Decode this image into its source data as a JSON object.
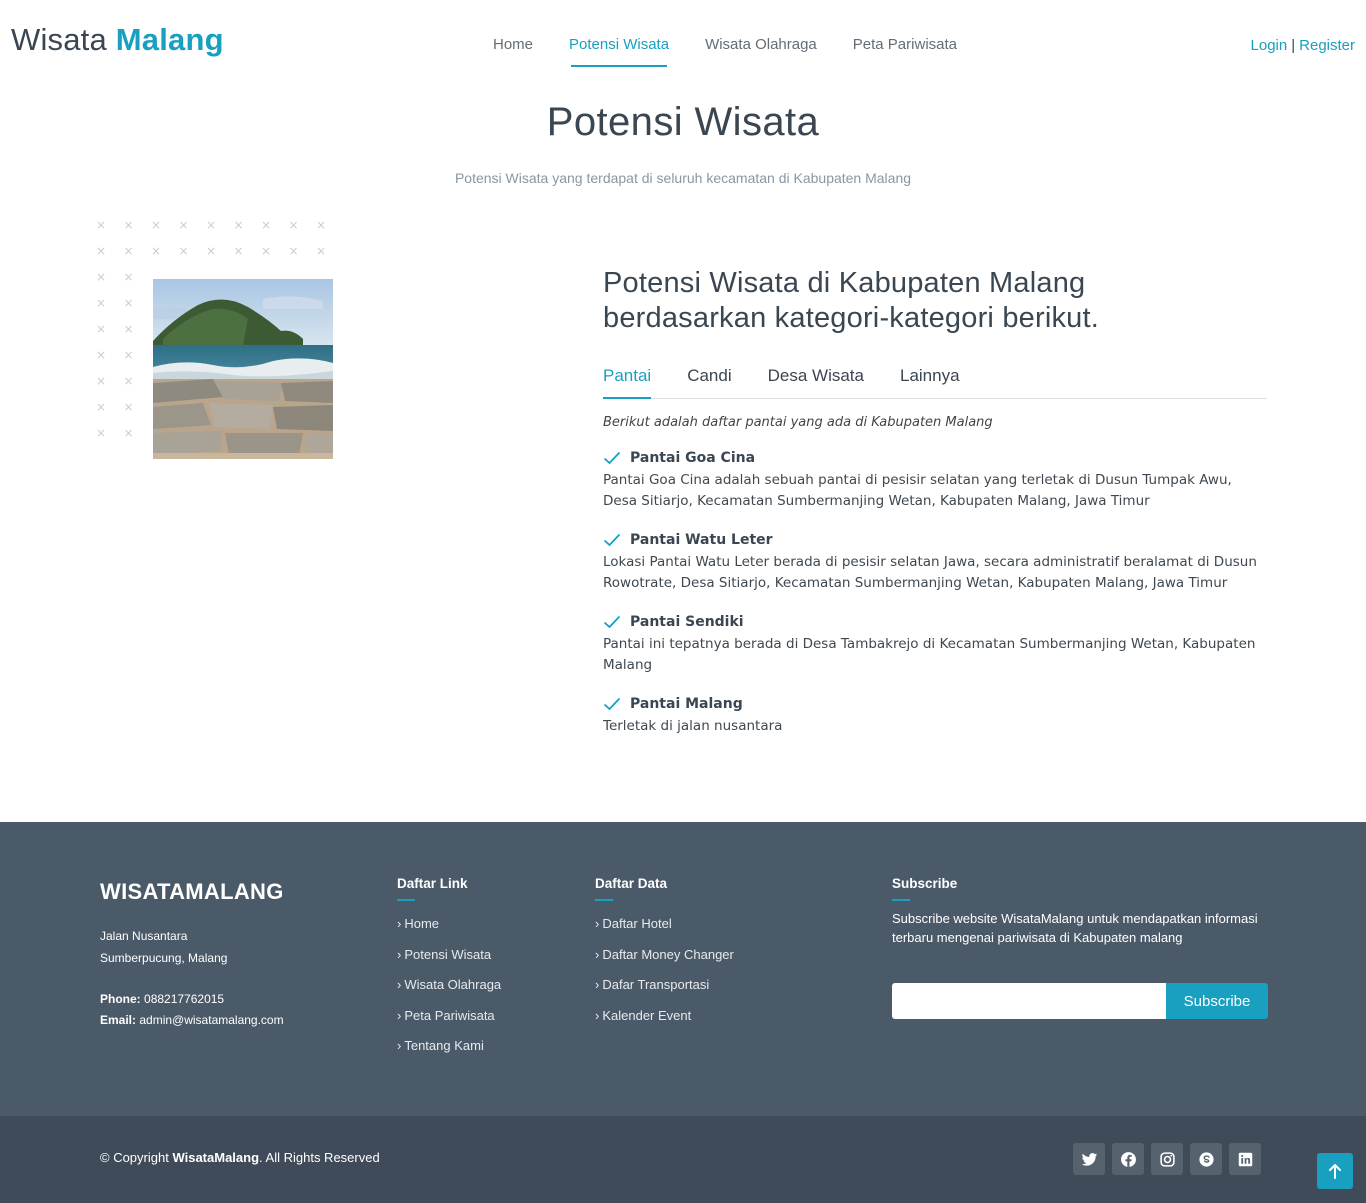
{
  "header": {
    "logo_part1": "Wisata",
    "logo_part2": "Malang",
    "nav": [
      {
        "label": "Home",
        "active": false
      },
      {
        "label": "Potensi Wisata",
        "active": true
      },
      {
        "label": "Wisata Olahraga",
        "active": false
      },
      {
        "label": "Peta Pariwisata",
        "active": false
      }
    ],
    "login": "Login",
    "separator": "|",
    "register": "Register"
  },
  "section": {
    "title": "Potensi Wisata",
    "subtitle": "Potensi Wisata yang terdapat di seluruh kecamatan di Kabupaten Malang"
  },
  "content": {
    "heading_line1": "Potensi Wisata di Kabupaten Malang",
    "heading_line2": "berdasarkan kategori-kategori berikut.",
    "tabs": [
      {
        "label": "Pantai",
        "active": true
      },
      {
        "label": "Candi",
        "active": false
      },
      {
        "label": "Desa Wisata",
        "active": false
      },
      {
        "label": "Lainnya",
        "active": false
      }
    ],
    "intro": "Berikut adalah daftar pantai yang ada di Kabupaten Malang",
    "items": [
      {
        "title": "Pantai Goa Cina",
        "desc": "Pantai Goa Cina adalah sebuah pantai di pesisir selatan yang terletak di Dusun Tumpak Awu, Desa Sitiarjo, Kecamatan Sumbermanjing Wetan, Kabupaten Malang, Jawa Timur"
      },
      {
        "title": "Pantai Watu Leter",
        "desc": "Lokasi Pantai Watu Leter berada di pesisir selatan Jawa, secara administratif beralamat di Dusun Rowotrate, Desa Sitiarjo, Kecamatan Sumbermanjing Wetan, Kabupaten Malang, Jawa Timur"
      },
      {
        "title": "Pantai Sendiki",
        "desc": "Pantai ini tepatnya berada di Desa Tambakrejo di Kecamatan Sumbermanjing Wetan, Kabupaten Malang"
      },
      {
        "title": "Pantai Malang",
        "desc": "Terletak di jalan nusantara"
      }
    ]
  },
  "footer": {
    "brand": "WISATAMALANG",
    "address_line1": "Jalan Nusantara",
    "address_line2": "Sumberpucung, Malang",
    "phone_label": "Phone:",
    "phone": "088217762015",
    "email_label": "Email:",
    "email": "admin@wisatamalang.com",
    "links_title": "Daftar Link",
    "links": [
      "Home",
      "Potensi Wisata",
      "Wisata Olahraga",
      "Peta Pariwisata",
      "Tentang Kami"
    ],
    "data_title": "Daftar Data",
    "data_links": [
      "Daftar Hotel",
      "Daftar Money Changer",
      "Dafar Transportasi",
      "Kalender Event"
    ],
    "subscribe_title": "Subscribe",
    "subscribe_text": "Subscribe website WisataMalang untuk mendapatkan informasi terbaru mengenai pariwisata di Kabupaten malang",
    "subscribe_placeholder": "",
    "subscribe_button": "Subscribe",
    "copyright_pre": "© Copyright",
    "copyright_brand": "WisataMalang",
    "copyright_post": ". All Rights Reserved",
    "socials": [
      "twitter-icon",
      "facebook-icon",
      "instagram-icon",
      "skype-icon",
      "linkedin-icon"
    ]
  },
  "colors": {
    "accent": "#199fc0",
    "heading": "#3a4651",
    "footer_top": "#4b5a68",
    "footer_bottom": "#3f4b58"
  }
}
